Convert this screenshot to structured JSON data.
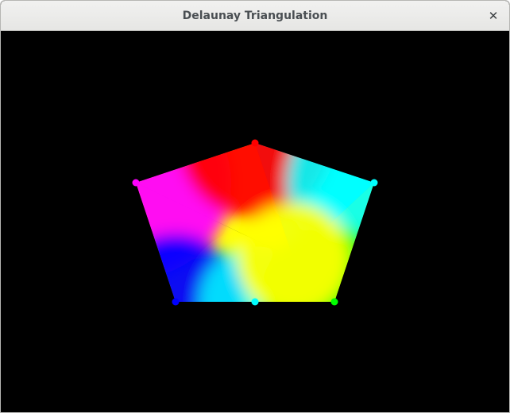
{
  "window": {
    "title": "Delaunay Triangulation",
    "close_icon": "close-icon"
  },
  "scene": {
    "background": "#000000",
    "vertices": [
      {
        "id": "top",
        "color": "#ff0000"
      },
      {
        "id": "left",
        "color": "#ff00ff"
      },
      {
        "id": "right",
        "color": "#00ffff"
      },
      {
        "id": "bottom-left",
        "color": "#0000ff"
      },
      {
        "id": "bottom-middle",
        "color": "#00ffff"
      },
      {
        "id": "bottom-right",
        "color": "#00ff00"
      },
      {
        "id": "interior",
        "color": "#ffff00"
      }
    ]
  }
}
